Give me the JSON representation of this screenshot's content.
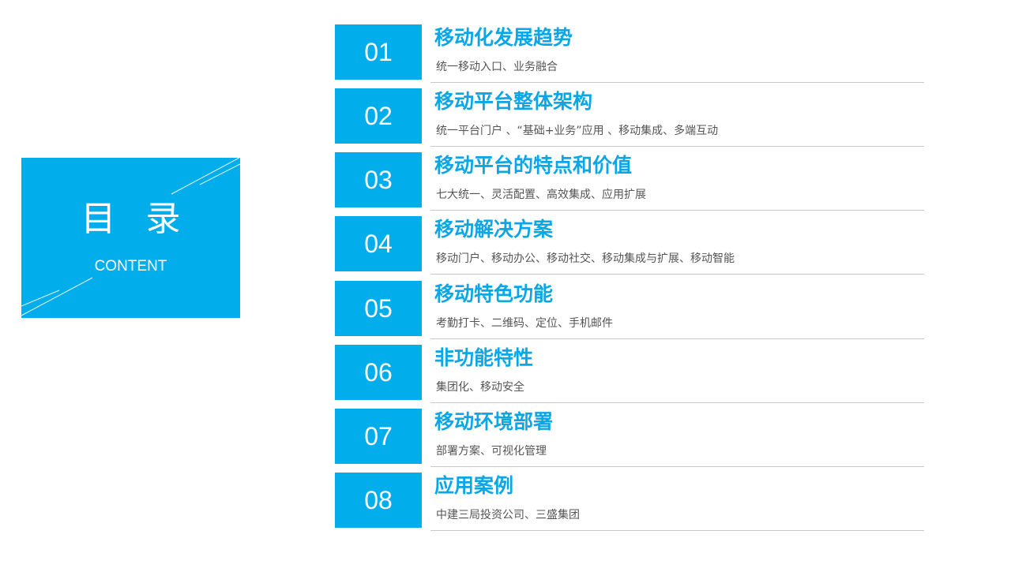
{
  "colors": {
    "accent": "#02adec",
    "title_text": "#0aa6e6",
    "desc_text": "#555555",
    "divider": "#c8c8c8"
  },
  "title_box": {
    "heading": "目 录",
    "subheading": "CONTENT"
  },
  "toc": [
    {
      "number": "01",
      "title": "移动化发展趋势",
      "description": "统一移动入口、业务融合"
    },
    {
      "number": "02",
      "title": "移动平台整体架构",
      "description": "统一平台门户 、“基础+业务”应用 、移动集成、多端互动"
    },
    {
      "number": "03",
      "title": "移动平台的特点和价值",
      "description": "七大统一、灵活配置、高效集成、应用扩展"
    },
    {
      "number": "04",
      "title": "移动解决方案",
      "description": "移动门户、移动办公、移动社交、移动集成与扩展、移动智能"
    },
    {
      "number": "05",
      "title": "移动特色功能",
      "description": "考勤打卡、二维码、定位、手机邮件"
    },
    {
      "number": "06",
      "title": "非功能特性",
      "description": "集团化、移动安全"
    },
    {
      "number": "07",
      "title": "移动环境部署",
      "description": "部署方案、可视化管理"
    },
    {
      "number": "08",
      "title": "应用案例",
      "description": "中建三局投资公司、三盛集团"
    }
  ]
}
